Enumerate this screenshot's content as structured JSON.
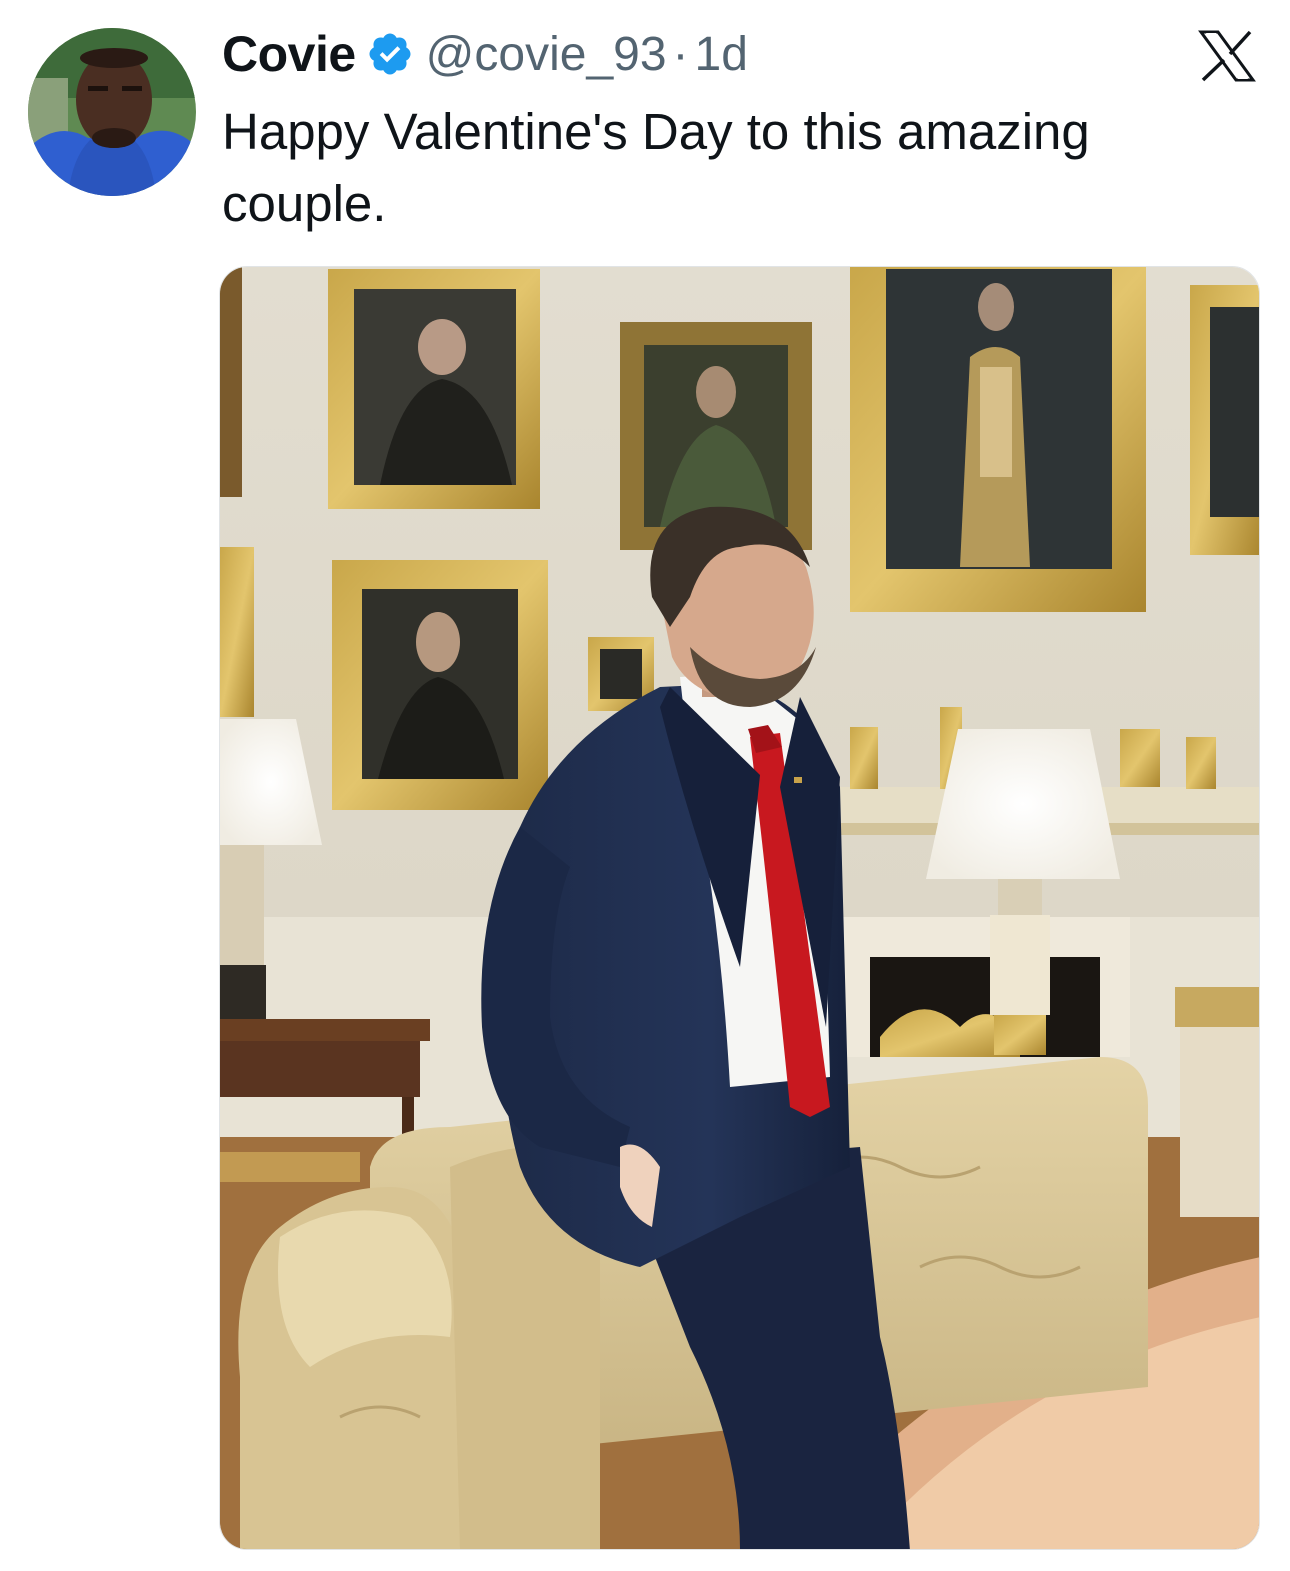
{
  "tweet": {
    "author_name": "Covie",
    "verified": true,
    "handle": "@covie_93",
    "separator": "·",
    "timestamp": "1d",
    "text": "Happy Valentine's Day to this amazing couple."
  },
  "icons": {
    "verified": "verified-badge-icon",
    "close": "x-logo-icon"
  },
  "colors": {
    "verified_blue": "#1d9bf0",
    "secondary_text": "#536471",
    "primary_text": "#0f1419"
  }
}
